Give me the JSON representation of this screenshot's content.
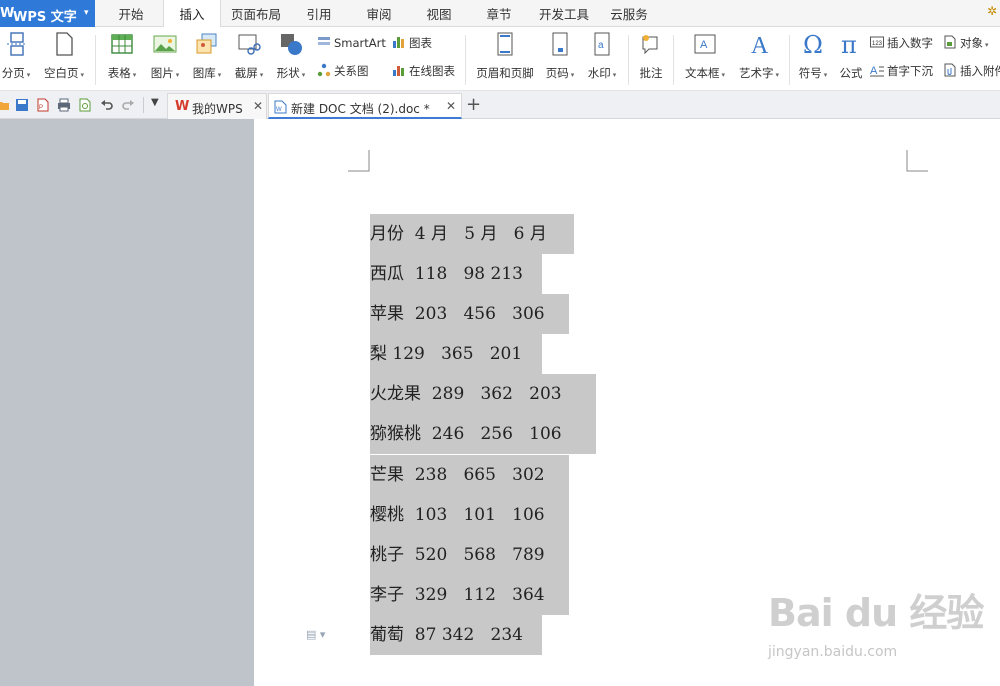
{
  "app": {
    "title": "WPS 文字",
    "logo": "W"
  },
  "menu_tabs": [
    "开始",
    "插入",
    "页面布局",
    "引用",
    "审阅",
    "视图",
    "章节",
    "开发工具",
    "云服务"
  ],
  "active_tab": "插入",
  "ribbon": {
    "page_break": "分页",
    "blank_page": "空白页",
    "table": "表格",
    "picture": "图片",
    "gallery": "图库",
    "screenshot": "截屏",
    "shape": "形状",
    "smartart": "SmartArt",
    "chart": "图表",
    "relation": "关系图",
    "online_chart": "在线图表",
    "header_footer": "页眉和页脚",
    "page_number": "页码",
    "watermark": "水印",
    "comment": "批注",
    "textbox": "文本框",
    "wordart": "艺术字",
    "symbol": "符号",
    "formula": "公式",
    "insert_number": "插入数字",
    "object": "对象",
    "drop_cap": "首字下沉",
    "attachment": "插入附件"
  },
  "doc_tabs": [
    {
      "label": "我的WPS"
    },
    {
      "label": "新建 DOC 文档 (2).doc *"
    }
  ],
  "document_lines": [
    "月份  4 月   5 月   6 月",
    "西瓜  118   98 213",
    "苹果  203   456   306",
    "梨 129   365   201",
    "火龙果  289   362   203",
    "猕猴桃  246   256   106",
    "芒果  238   665   302",
    "樱桃  103   101   106",
    "桃子  520   568   789",
    "李子  329   112   364",
    "葡萄  87 342   234"
  ],
  "watermark": {
    "brand": "Bai du 经验",
    "url": "jingyan.baidu.com"
  },
  "colors": {
    "accent": "#2f7ad8",
    "selection": "#c8c8c8",
    "sidebar": "#bfc3ca"
  }
}
